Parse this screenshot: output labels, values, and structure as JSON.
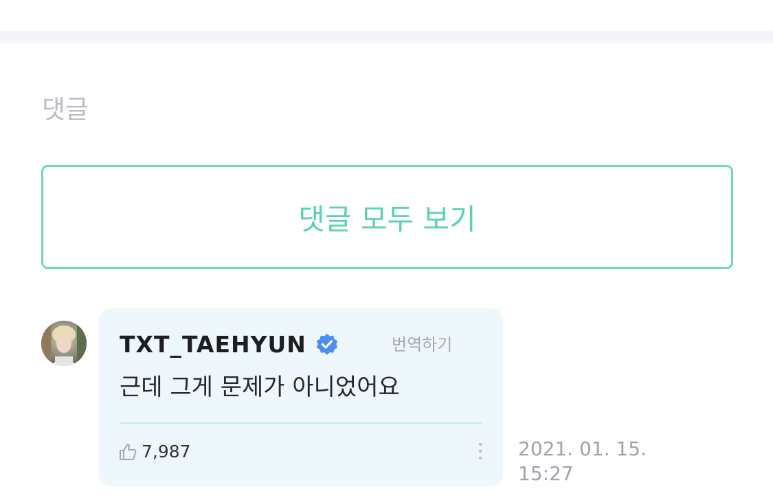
{
  "section": {
    "title": "댓글"
  },
  "view_all_button": {
    "label": "댓글 모두 보기"
  },
  "colors": {
    "accent": "#5cd1b4",
    "bubble_bg": "#eef7fc",
    "verified": "#4a8ff0"
  },
  "comment": {
    "author": "TXT_TAEHYUN",
    "verified_icon": "verified-badge-icon",
    "translate_label": "번역하기",
    "text": "근데 그게 문제가 아니었어요",
    "like_icon": "thumbs-up-icon",
    "likes": "7,987",
    "more_icon": "more-vertical-icon",
    "date": "2021. 01. 15.",
    "time": "15:27"
  }
}
